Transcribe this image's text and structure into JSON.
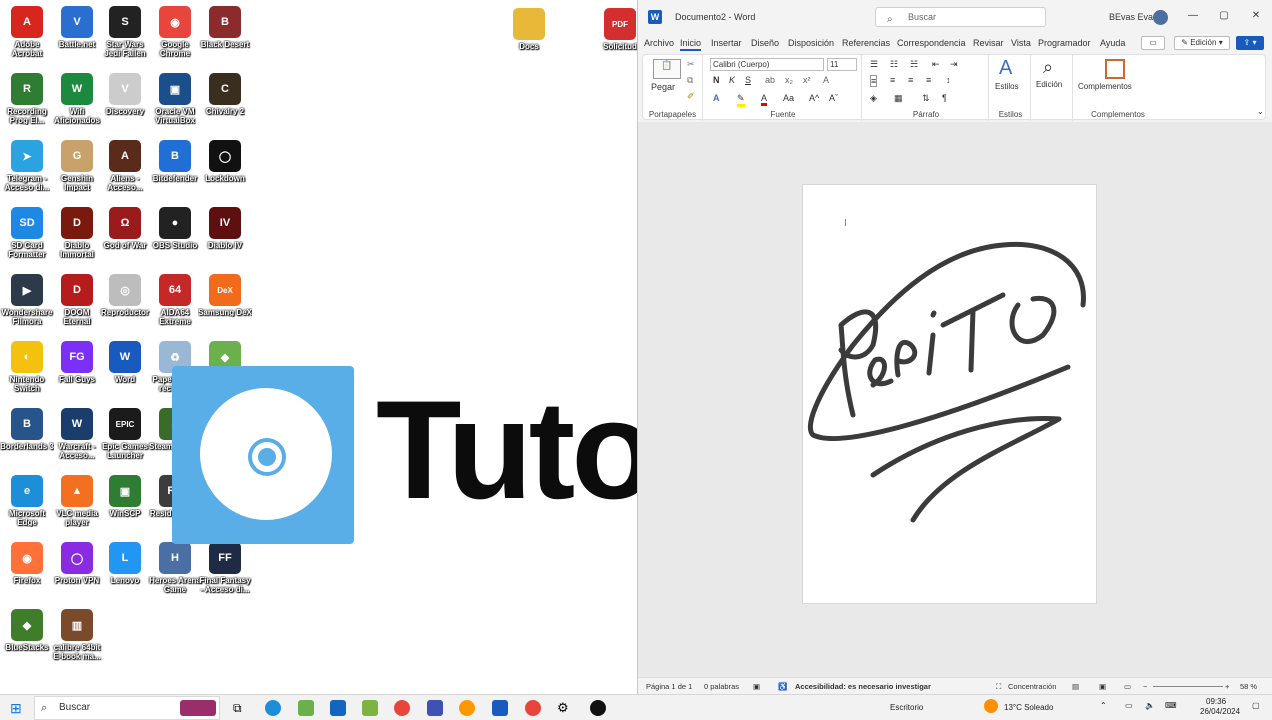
{
  "desktop": {
    "icons": [
      {
        "label": "Adobe Acrobat",
        "color": "#d7261e",
        "glyph": "A"
      },
      {
        "label": "Battle.net",
        "color": "#2a6fd0",
        "glyph": "V"
      },
      {
        "label": "Star Wars Jedi Fallen Order",
        "color": "#222222",
        "glyph": "S"
      },
      {
        "label": "Google Chrome",
        "color": "#e8453c",
        "glyph": "◉"
      },
      {
        "label": "Black Desert",
        "color": "#8c2b2b",
        "glyph": "B"
      },
      {
        "label": "Recording Prog El...",
        "color": "#2e7d32",
        "glyph": "R"
      },
      {
        "label": "Wifi Aficionados",
        "color": "#1b8a3e",
        "glyph": "W"
      },
      {
        "label": "Discovery",
        "color": "#cccccc",
        "glyph": "V"
      },
      {
        "label": "Oracle VM VirtualBox",
        "color": "#1a4f8b",
        "glyph": "▣"
      },
      {
        "label": "Chivalry 2",
        "color": "#3a2f1e",
        "glyph": "C"
      },
      {
        "label": "Telegram - Acceso di...",
        "color": "#2aa3e0",
        "glyph": "➤"
      },
      {
        "label": "Genshin Impact",
        "color": "#c9a26b",
        "glyph": "G"
      },
      {
        "label": "Aliens - Acceso...",
        "color": "#5a2a1a",
        "glyph": "A"
      },
      {
        "label": "Bitdefender",
        "color": "#1f6fd6",
        "glyph": "B"
      },
      {
        "label": "Lockdown",
        "color": "#111111",
        "glyph": "◯"
      },
      {
        "label": "SD Card Formatter",
        "color": "#1e88e5",
        "glyph": "SD"
      },
      {
        "label": "Diablo Immortal",
        "color": "#7a1a0e",
        "glyph": "D"
      },
      {
        "label": "God of War",
        "color": "#9a1b1b",
        "glyph": "Ω"
      },
      {
        "label": "OBS Studio",
        "color": "#222222",
        "glyph": "●"
      },
      {
        "label": "Diablo IV",
        "color": "#5e1010",
        "glyph": "IV"
      },
      {
        "label": "Wondershare Filmora",
        "color": "#2d3a4a",
        "glyph": "▶"
      },
      {
        "label": "DOOM Eternal",
        "color": "#b71c1c",
        "glyph": "D"
      },
      {
        "label": "Reproductor",
        "color": "#bdbdbd",
        "glyph": "◎"
      },
      {
        "label": "AIDA64 Extreme",
        "color": "#c62828",
        "glyph": "64"
      },
      {
        "label": "Samsung DeX",
        "color": "#f26b1d",
        "glyph": "DeX"
      },
      {
        "label": "Nintendo Switch",
        "color": "#f4c20d",
        "glyph": "◐"
      },
      {
        "label": "Fall Guys",
        "color": "#7b2ff7",
        "glyph": "FG"
      },
      {
        "label": "Word",
        "color": "#185abd",
        "glyph": "W"
      },
      {
        "label": "Papelera de reciclaje",
        "color": "#9ab7d6",
        "glyph": "♻"
      },
      {
        "label": "BlueStacks",
        "color": "#6ab04c",
        "glyph": "◆"
      },
      {
        "label": "Borderlands 3",
        "color": "#27548a",
        "glyph": "B"
      },
      {
        "label": "Warcraft - Acceso...",
        "color": "#1a3d6b",
        "glyph": "W"
      },
      {
        "label": "Epic Games Launcher",
        "color": "#1b1b1b",
        "glyph": "EPIC"
      },
      {
        "label": "Steam Deck 2",
        "color": "#3b6b2a",
        "glyph": "S"
      },
      {
        "label": "Wheel Spin",
        "color": "#444444",
        "glyph": "⊛"
      },
      {
        "label": "Microsoft Edge",
        "color": "#1d8fd8",
        "glyph": "e"
      },
      {
        "label": "VLC media player",
        "color": "#f37021",
        "glyph": "▲"
      },
      {
        "label": "WinSCP",
        "color": "#2f7d32",
        "glyph": "▣"
      },
      {
        "label": "Resident Evil 7",
        "color": "#3c3c3c",
        "glyph": "RE"
      },
      {
        "label": "Capcom - Acceso...",
        "color": "#5b3d2b",
        "glyph": "C"
      },
      {
        "label": "Firefox",
        "color": "#ff7139",
        "glyph": "◉"
      },
      {
        "label": "Proton VPN",
        "color": "#8a2be2",
        "glyph": "◯"
      },
      {
        "label": "Lenovo",
        "color": "#2196f3",
        "glyph": "L"
      },
      {
        "label": "Heroes Arena Game",
        "color": "#4a6fa5",
        "glyph": "H"
      },
      {
        "label": "Final Fantasy - Acceso di...",
        "color": "#1f2a44",
        "glyph": "FF"
      },
      {
        "label": "BlueStacks",
        "color": "#3f7d2a",
        "glyph": "◆"
      },
      {
        "label": "calibre 64bit E-book ma...",
        "color": "#7a4a2a",
        "glyph": "▥"
      }
    ],
    "top_folder": {
      "label": "Docs",
      "color": "#e8b838"
    },
    "top_pdf": {
      "label": "Solicitud",
      "color": "#d32f2f",
      "glyph": "PDF"
    },
    "watermark_text": "Tuto"
  },
  "word": {
    "title": "Documento2 - Word",
    "search_placeholder": "Buscar",
    "user": "BEvas Evas",
    "menu_tabs": [
      "Archivo",
      "Inicio",
      "Insertar",
      "Diseño",
      "Disposición",
      "Referencias",
      "Correspondencia",
      "Revisar",
      "Vista",
      "Programador",
      "Ayuda"
    ],
    "active_tab": "Inicio",
    "editing_button": "Edición",
    "ribbon": {
      "clipboard": {
        "paste": "Pegar",
        "label": "Portapapeles"
      },
      "font": {
        "name": "Calibri (Cuerpo)",
        "size": "11",
        "label": "Fuente",
        "bold": "N",
        "italic": "K",
        "underline": "S"
      },
      "paragraph": {
        "label": "Párrafo"
      },
      "styles": {
        "button": "Estilos",
        "label": "Estilos"
      },
      "editing": {
        "button": "Edición"
      },
      "addins": {
        "button": "Complementos",
        "label": "Complementos"
      }
    },
    "signature_text": "Pepito",
    "status": {
      "page": "Página 1 de 1",
      "words": "0 palabras",
      "accessibility": "Accesibilidad: es necesario investigar",
      "focus": "Concentración",
      "zoom": "58 %"
    }
  },
  "taskbar": {
    "search_placeholder": "Buscar",
    "desktop_label": "Escritorio",
    "weather": "13°C  Soleado",
    "time": "09:36",
    "date": "26/04/2024"
  }
}
